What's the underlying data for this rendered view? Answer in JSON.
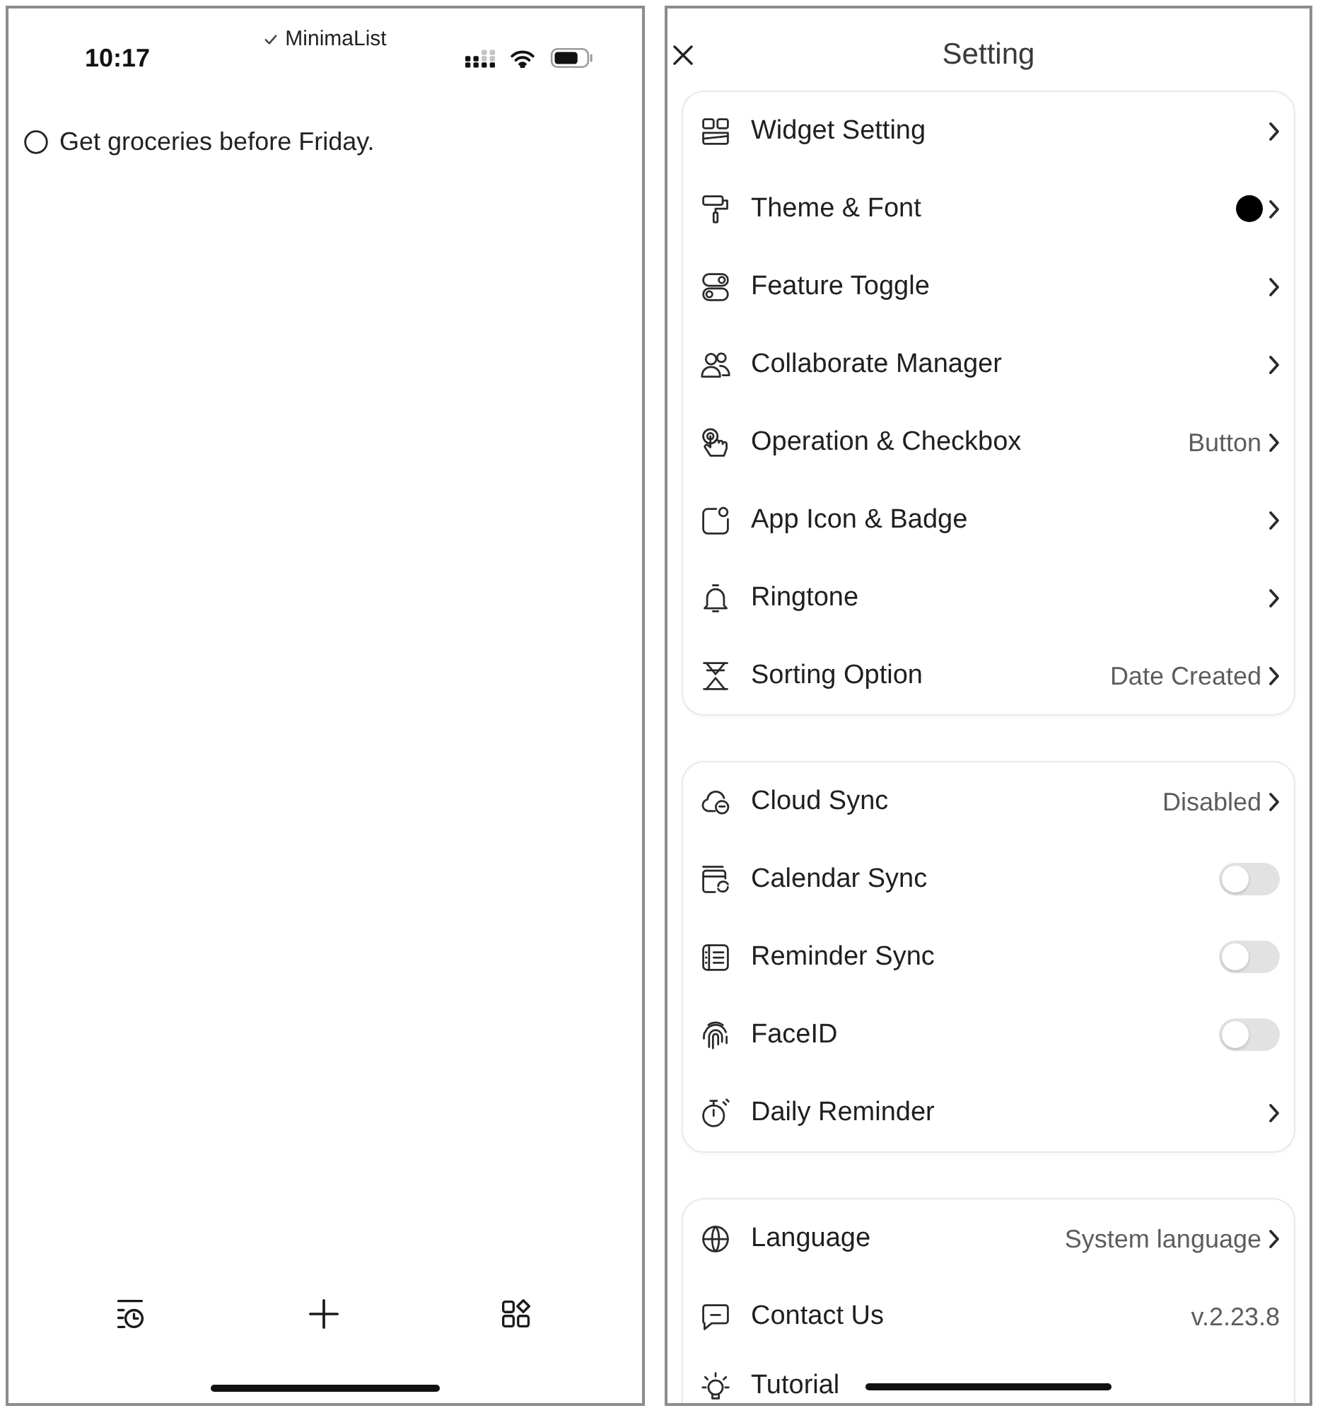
{
  "left_screen": {
    "status_bar": {
      "time": "10:17",
      "app_name": "MinimaList"
    },
    "tasks": [
      {
        "title": "Get groceries before Friday.",
        "done": false
      }
    ]
  },
  "right_screen": {
    "title": "Setting",
    "sections": [
      {
        "rows": [
          {
            "kind": "link",
            "label": "Widget Setting"
          },
          {
            "kind": "swatch",
            "label": "Theme & Font",
            "color": "#000000"
          },
          {
            "kind": "link",
            "label": "Feature Toggle"
          },
          {
            "kind": "link",
            "label": "Collaborate Manager"
          },
          {
            "kind": "link",
            "label": "Operation & Checkbox",
            "value": "Button"
          },
          {
            "kind": "link",
            "label": "App Icon & Badge"
          },
          {
            "kind": "link",
            "label": "Ringtone"
          },
          {
            "kind": "link",
            "label": "Sorting Option",
            "value": "Date Created"
          }
        ]
      },
      {
        "rows": [
          {
            "kind": "link",
            "label": "Cloud Sync",
            "value": "Disabled"
          },
          {
            "kind": "toggle",
            "label": "Calendar Sync",
            "on": false
          },
          {
            "kind": "toggle",
            "label": "Reminder Sync",
            "on": false
          },
          {
            "kind": "toggle",
            "label": "FaceID",
            "on": false
          },
          {
            "kind": "link",
            "label": "Daily Reminder"
          }
        ]
      },
      {
        "rows": [
          {
            "kind": "link",
            "label": "Language",
            "value": "System language"
          },
          {
            "kind": "info",
            "label": "Contact Us",
            "value": "v.2.23.8"
          },
          {
            "kind": "plain",
            "label": "Tutorial"
          }
        ]
      }
    ]
  }
}
